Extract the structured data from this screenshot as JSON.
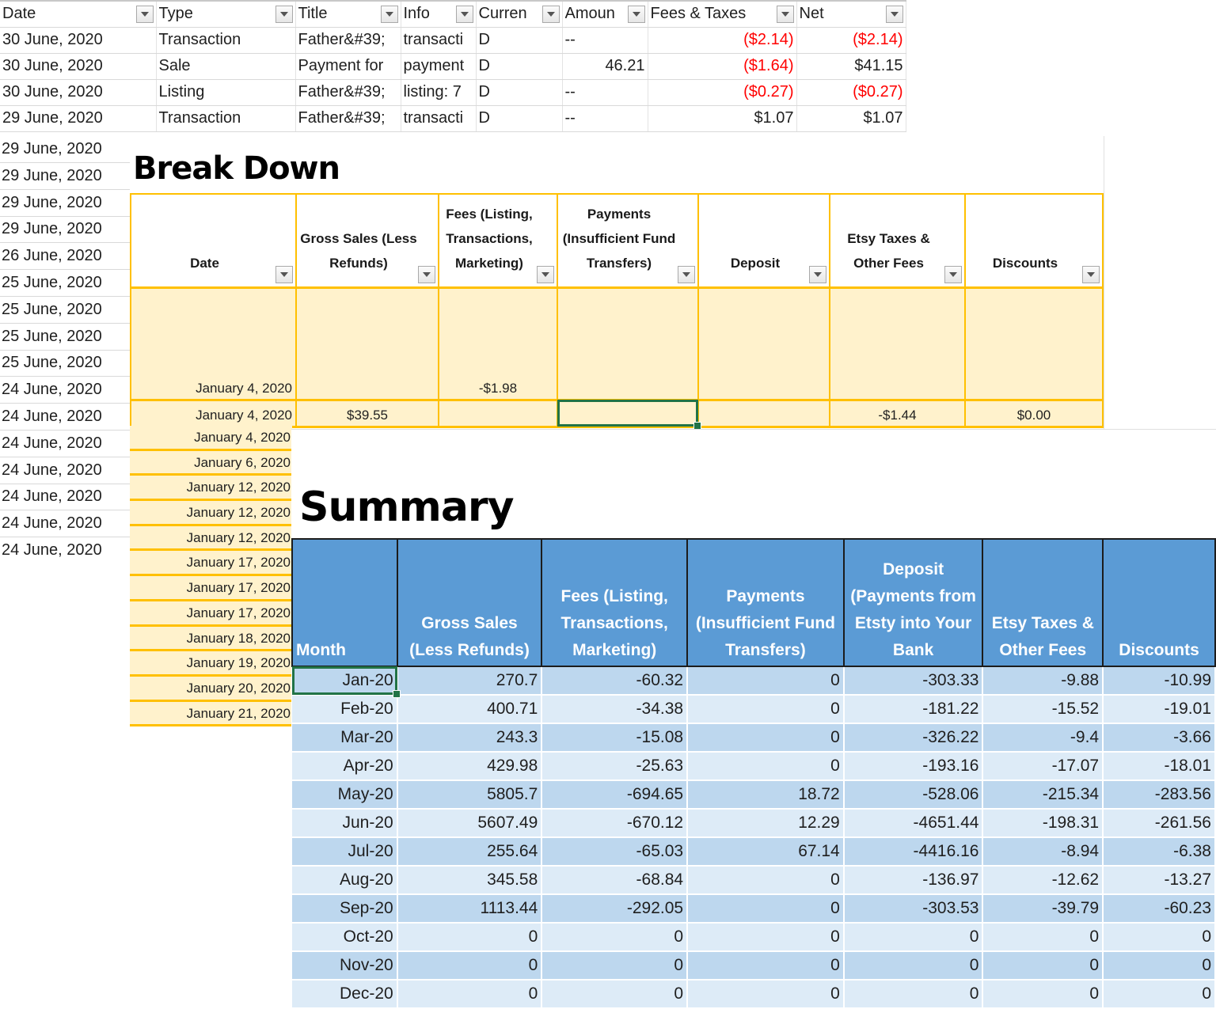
{
  "transactions": {
    "columns": [
      "Date",
      "Type",
      "Title",
      "Info",
      "Currency",
      "Amount",
      "Fees & Taxes",
      "Net"
    ],
    "columns_display": [
      "Date",
      "Type",
      "Title",
      "Info",
      "Curren",
      "Amoun",
      "Fees & Taxes",
      "Net"
    ],
    "rows": [
      {
        "date": "30 June, 2020",
        "type": "Transaction",
        "title": "Father&#39;",
        "info": "transacti",
        "currency": "D",
        "amount": "--",
        "fees": "($2.14)",
        "net": "($2.14)",
        "fees_neg": true,
        "net_neg": true
      },
      {
        "date": "30 June, 2020",
        "type": "Sale",
        "title": "Payment for",
        "info": "payment",
        "currency": "D",
        "amount": "46.21",
        "fees": "($1.64)",
        "net": "$41.15",
        "fees_neg": true,
        "net_neg": false
      },
      {
        "date": "30 June, 2020",
        "type": "Listing",
        "title": "Father&#39;",
        "info": "listing: 7",
        "currency": "D",
        "amount": "--",
        "fees": "($0.27)",
        "net": "($0.27)",
        "fees_neg": true,
        "net_neg": true
      },
      {
        "date": "29 June, 2020",
        "type": "Transaction",
        "title": "Father&#39;",
        "info": "transacti",
        "currency": "D",
        "amount": "--",
        "fees": "$1.07",
        "net": "$1.07",
        "fees_neg": false,
        "net_neg": false
      }
    ],
    "more_dates": [
      "29 June, 2020",
      "29 June, 2020",
      "29 June, 2020",
      "29 June, 2020",
      "26 June, 2020",
      "25 June, 2020",
      "25 June, 2020",
      "25 June, 2020",
      "25 June, 2020",
      "24 June, 2020",
      "24 June, 2020",
      "24 June, 2020",
      "24 June, 2020",
      "24 June, 2020",
      "24 June, 2020",
      "24 June, 2020"
    ]
  },
  "breakdown": {
    "title": "Break Down",
    "columns": [
      "Date",
      "Gross Sales (Less Refunds)",
      "Fees (Listing, Transactions, Marketing)",
      "Payments (Insufficient Fund Transfers)",
      "Deposit",
      "Etsy Taxes & Other Fees",
      "Discounts"
    ],
    "rows": [
      {
        "date": "January 4, 2020",
        "gross": "",
        "fees": "-$1.98",
        "payments": "",
        "deposit": "",
        "taxes": "",
        "discounts": ""
      },
      {
        "date": "January 4, 2020",
        "gross": "$39.55",
        "fees": "",
        "payments": "",
        "deposit": "",
        "taxes": "-$1.44",
        "discounts": "$0.00"
      }
    ],
    "more_dates": [
      "January 4, 2020",
      "January 6, 2020",
      "January 12, 2020",
      "January 12, 2020",
      "January 12, 2020",
      "January 17, 2020",
      "January 17, 2020",
      "January 17, 2020",
      "January 18, 2020",
      "January 19, 2020",
      "January 20, 2020",
      "January 21, 2020"
    ]
  },
  "summary": {
    "title": "Summary",
    "columns": [
      "Month",
      "Gross Sales (Less Refunds)",
      "Fees (Listing, Transactions, Marketing)",
      "Payments (Insufficient Fund Transfers)",
      "Deposit (Payments from Etsty into Your Bank",
      "Etsy Taxes & Other Fees",
      "Discounts"
    ],
    "rows": [
      [
        "Jan-20",
        "270.7",
        "-60.32",
        "0",
        "-303.33",
        "-9.88",
        "-10.99"
      ],
      [
        "Feb-20",
        "400.71",
        "-34.38",
        "0",
        "-181.22",
        "-15.52",
        "-19.01"
      ],
      [
        "Mar-20",
        "243.3",
        "-15.08",
        "0",
        "-326.22",
        "-9.4",
        "-3.66"
      ],
      [
        "Apr-20",
        "429.98",
        "-25.63",
        "0",
        "-193.16",
        "-17.07",
        "-18.01"
      ],
      [
        "May-20",
        "5805.7",
        "-694.65",
        "18.72",
        "-528.06",
        "-215.34",
        "-283.56"
      ],
      [
        "Jun-20",
        "5607.49",
        "-670.12",
        "12.29",
        "-4651.44",
        "-198.31",
        "-261.56"
      ],
      [
        "Jul-20",
        "255.64",
        "-65.03",
        "67.14",
        "-4416.16",
        "-8.94",
        "-6.38"
      ],
      [
        "Aug-20",
        "345.58",
        "-68.84",
        "0",
        "-136.97",
        "-12.62",
        "-13.27"
      ],
      [
        "Sep-20",
        "1113.44",
        "-292.05",
        "0",
        "-303.53",
        "-39.79",
        "-60.23"
      ],
      [
        "Oct-20",
        "0",
        "0",
        "0",
        "0",
        "0",
        "0"
      ],
      [
        "Nov-20",
        "0",
        "0",
        "0",
        "0",
        "0",
        "0"
      ],
      [
        "Dec-20",
        "0",
        "0",
        "0",
        "0",
        "0",
        "0"
      ]
    ],
    "selected_cell": "Jan-20"
  },
  "colors": {
    "negative": "#ff0000",
    "breakdown_border": "#ffc000",
    "breakdown_fill": "#fff2cc",
    "summary_header": "#5b9bd5",
    "summary_band_1": "#bdd7ee",
    "summary_band_2": "#ddebf7",
    "selection": "#217346"
  }
}
